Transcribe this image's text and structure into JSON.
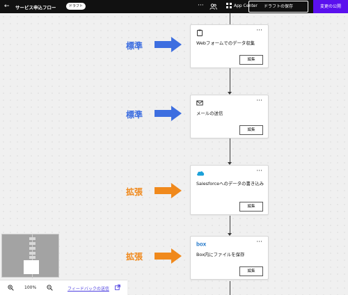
{
  "header": {
    "back_icon": "arrow-left-icon",
    "title": "サービス申込フロー",
    "badge": "ドラフト",
    "more": "···",
    "app_center": "App Center",
    "save_draft": "ドラフトの保存",
    "publish": "変更の公開",
    "accent": "#5a10ee"
  },
  "steps": [
    {
      "icon": "clipboard-icon",
      "label": "Webフォームでのデータ収集",
      "edit": "編集",
      "more": "···",
      "annotation": "標準",
      "annotation_color": "#3d6ee0"
    },
    {
      "icon": "mail-icon",
      "label": "メールの送信",
      "edit": "編集",
      "more": "···",
      "annotation": "標準",
      "annotation_color": "#3d6ee0"
    },
    {
      "icon": "salesforce-icon",
      "label": "Salesforceへのデータの書き込み",
      "edit": "編集",
      "more": "···",
      "annotation": "拡張",
      "annotation_color": "#f0891c"
    },
    {
      "icon": "box-icon",
      "label": "Box内にファイルを保存",
      "edit": "編集",
      "more": "···",
      "annotation": "拡張",
      "annotation_color": "#f0891c"
    }
  ],
  "zoom": {
    "level": "100%",
    "feedback": "フィードバックの送信"
  }
}
